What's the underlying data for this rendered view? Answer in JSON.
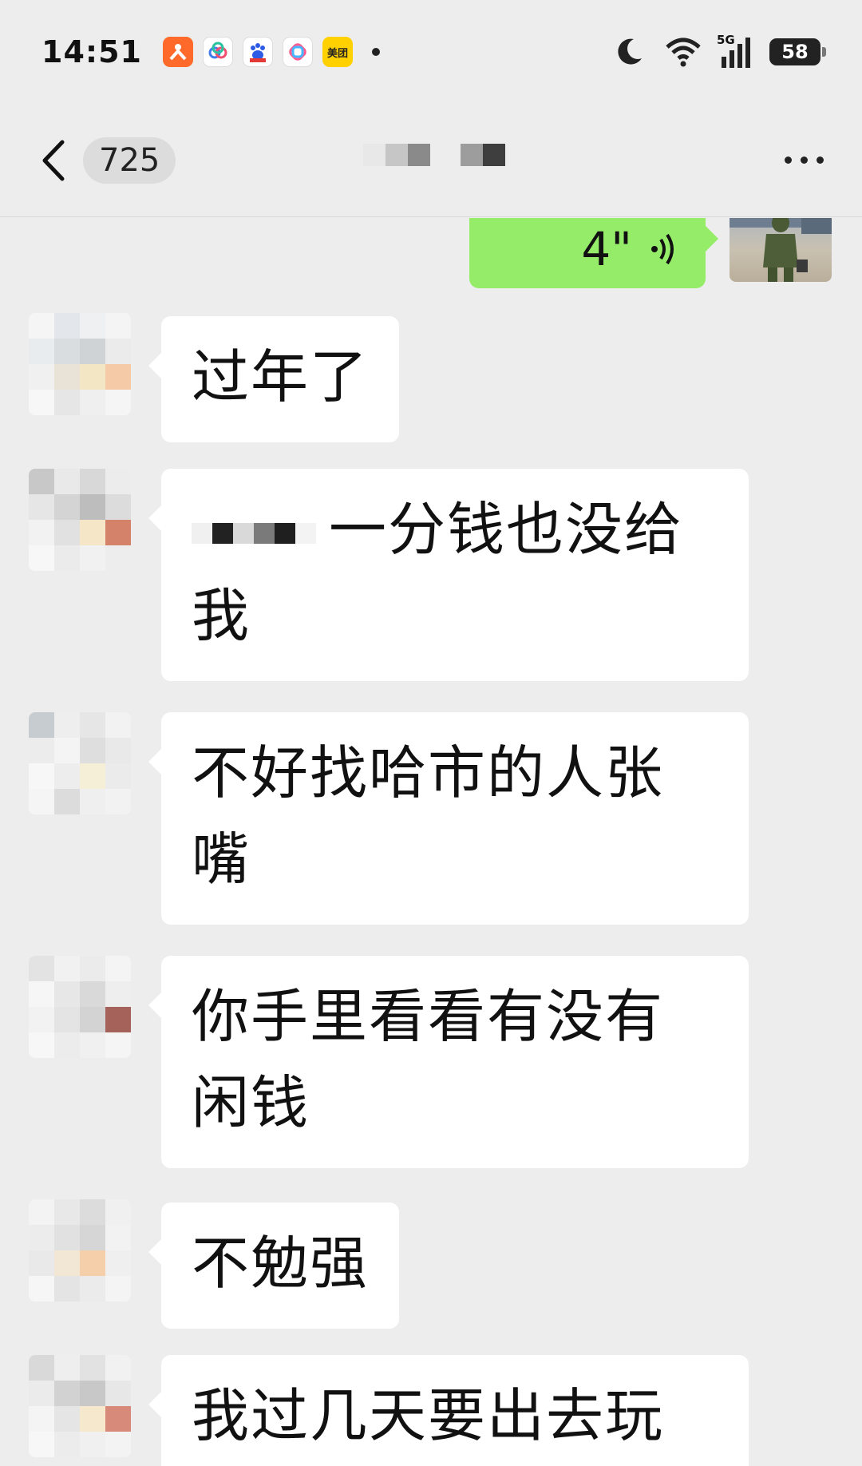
{
  "status_bar": {
    "time": "14:51",
    "apps": [
      {
        "icon": "app-orange-icon",
        "color": "#ff6a2b",
        "label": ""
      },
      {
        "icon": "app-rings-icon",
        "color": "#ffffff",
        "label": ""
      },
      {
        "icon": "baidu-icon",
        "color": "#ffffff",
        "label": ""
      },
      {
        "icon": "app-flower-icon",
        "color": "#ffffff",
        "label": ""
      },
      {
        "icon": "meituan-icon",
        "color": "#ffd100",
        "label": "美团"
      }
    ],
    "signal_label": "5G",
    "battery": "58"
  },
  "header": {
    "unread_count": "725",
    "title_redacted": true
  },
  "messages": [
    {
      "side": "right",
      "type": "voice",
      "duration": "4\""
    },
    {
      "side": "left",
      "type": "text",
      "lines": [
        "过年了"
      ]
    },
    {
      "side": "left",
      "type": "text",
      "redacted_prefix": true,
      "lines": [
        "一分钱也没给",
        "我"
      ]
    },
    {
      "side": "left",
      "type": "text",
      "lines": [
        "不好找哈市的人张",
        "嘴"
      ]
    },
    {
      "side": "left",
      "type": "text",
      "lines": [
        "你手里看看有没有",
        "闲钱"
      ]
    },
    {
      "side": "left",
      "type": "text",
      "lines": [
        "不勉强"
      ]
    },
    {
      "side": "left",
      "type": "text",
      "lines": [
        "我过几天要出去玩"
      ]
    }
  ],
  "colors": {
    "background": "#ededed",
    "incoming_bubble": "#ffffff",
    "outgoing_bubble": "#95ec69"
  }
}
